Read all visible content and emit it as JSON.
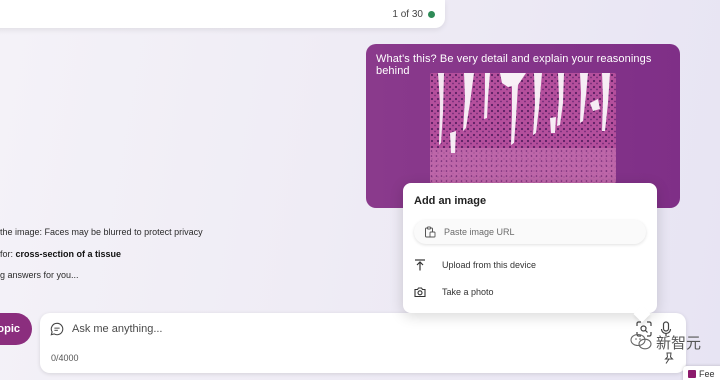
{
  "header": {
    "counter_text": "1 of 30",
    "counter_dot_color": "#2e8b57"
  },
  "conversation": {
    "user_message": "What's this? Be very detail and explain your reasonings behind",
    "user_bubble_color": "#8a3a8c",
    "attached_image": "histology-tissue-section"
  },
  "status": {
    "line1": "the image: Faces may be blurred to protect privacy",
    "line2_prefix": "for: ",
    "line2_bold": "cross-section of a tissue",
    "line3": "g answers for you..."
  },
  "topic_button": {
    "label": "opic",
    "color": "#8b2e7e"
  },
  "composer": {
    "placeholder": "Ask me anything...",
    "char_count": "0/4000",
    "icons": [
      "chat-icon",
      "visual-search-icon",
      "microphone-icon"
    ]
  },
  "add_image_popover": {
    "title": "Add an image",
    "url_placeholder": "Paste image URL",
    "upload_label": "Upload from this device",
    "photo_label": "Take a photo"
  },
  "overlay": {
    "watermark_text": "新智元",
    "feedback_label": "Fee"
  }
}
